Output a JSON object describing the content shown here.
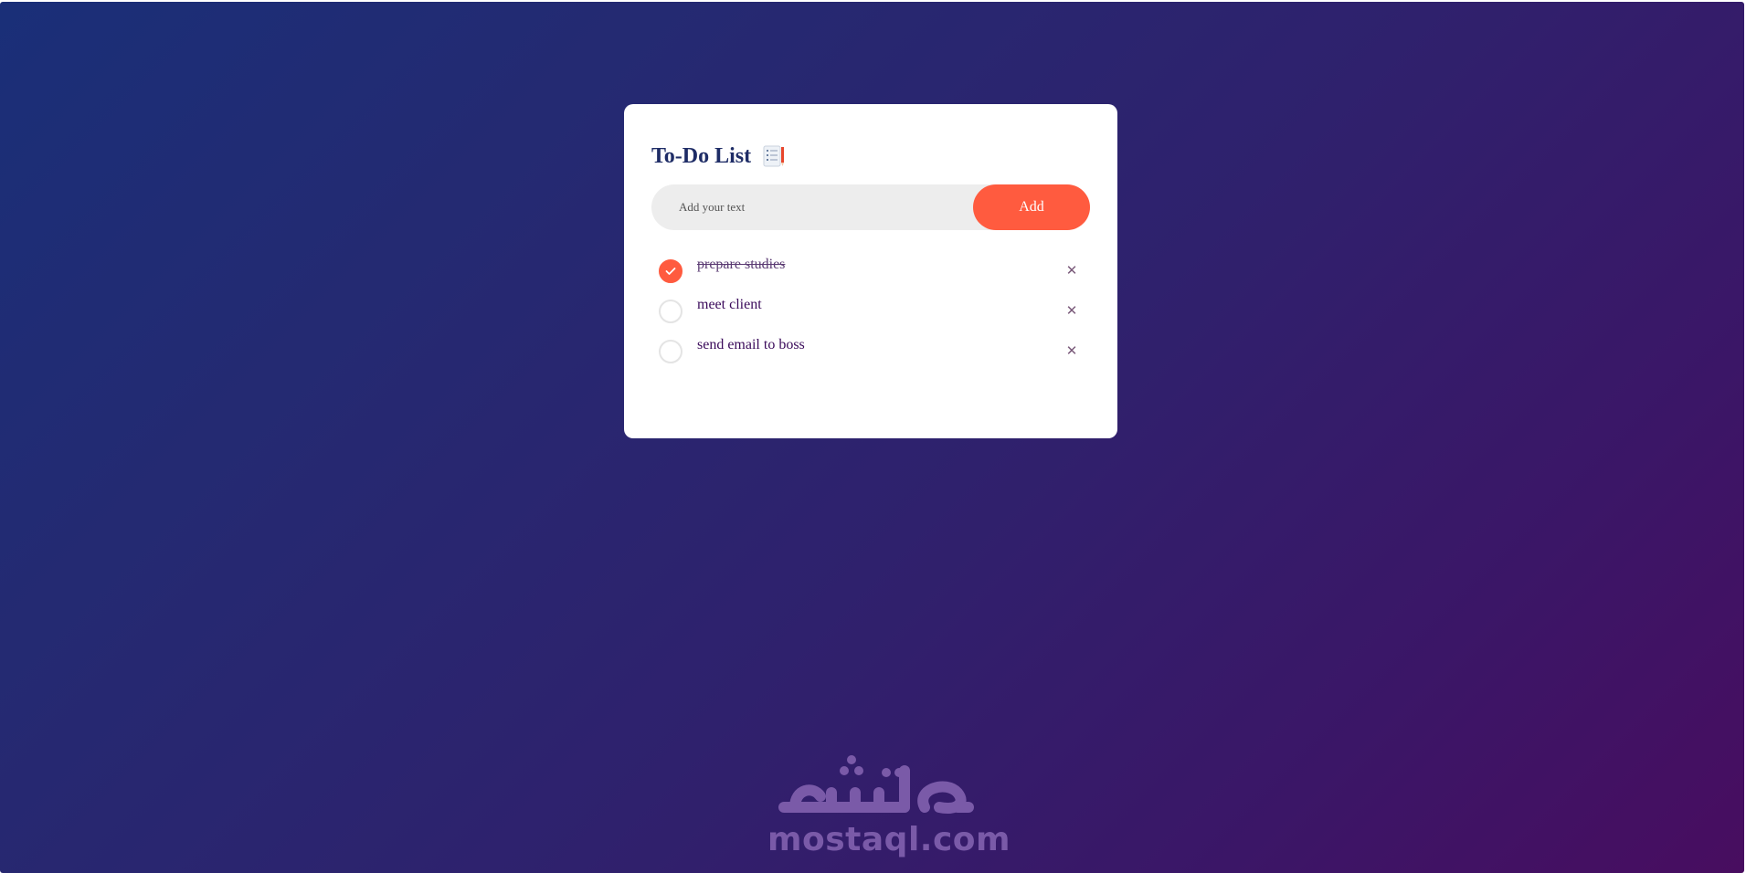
{
  "app": {
    "title": "To-Do List",
    "title_icon": "clipboard-pencil-icon"
  },
  "input": {
    "placeholder": "Add your text",
    "value": ""
  },
  "add_button": {
    "label": "Add"
  },
  "tasks": [
    {
      "text": "prepare studies",
      "completed": true
    },
    {
      "text": "meet client",
      "completed": false
    },
    {
      "text": "send email to boss",
      "completed": false
    }
  ],
  "colors": {
    "accent": "#ff5b3f",
    "title": "#1e2c66",
    "task_text": "#3a0a5a",
    "gradient_start": "#1a2f78",
    "gradient_end": "#480d60"
  },
  "watermark": {
    "arabic": "مستقل",
    "text": "mostaql.com"
  }
}
